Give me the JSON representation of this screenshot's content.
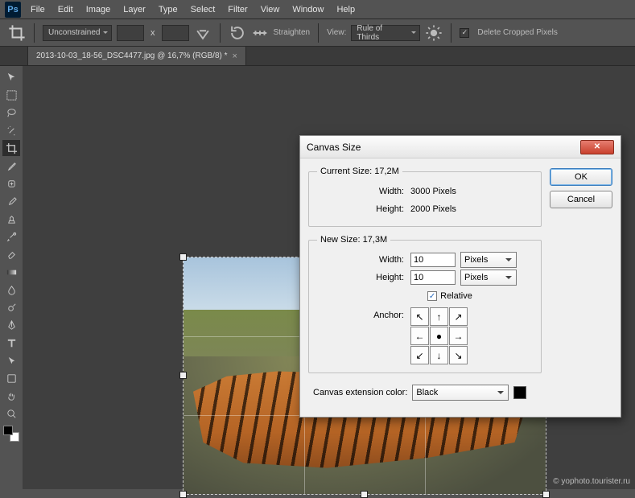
{
  "menu": {
    "items": [
      "File",
      "Edit",
      "Image",
      "Layer",
      "Type",
      "Select",
      "Filter",
      "View",
      "Window",
      "Help"
    ]
  },
  "options": {
    "ratio_mode": "Unconstrained",
    "x_sep": "x",
    "straighten": "Straighten",
    "view_label": "View:",
    "overlay": "Rule of Thirds",
    "delete_cropped": "Delete Cropped Pixels"
  },
  "tab": {
    "title": "2013-10-03_18-56_DSC4477.jpg @ 16,7% (RGB/8) *",
    "close": "×"
  },
  "dialog": {
    "title": "Canvas Size",
    "ok": "OK",
    "cancel": "Cancel",
    "current": {
      "legend": "Current Size: 17,2M",
      "width_label": "Width:",
      "width_value": "3000 Pixels",
      "height_label": "Height:",
      "height_value": "2000 Pixels"
    },
    "new": {
      "legend": "New Size: 17,3M",
      "width_label": "Width:",
      "width_value": "10",
      "width_unit": "Pixels",
      "height_label": "Height:",
      "height_value": "10",
      "height_unit": "Pixels",
      "relative_label": "Relative",
      "anchor_label": "Anchor:"
    },
    "ext_label": "Canvas extension color:",
    "ext_value": "Black",
    "ext_swatch": "#000000"
  },
  "watermark": "© yophoto.tourister.ru"
}
